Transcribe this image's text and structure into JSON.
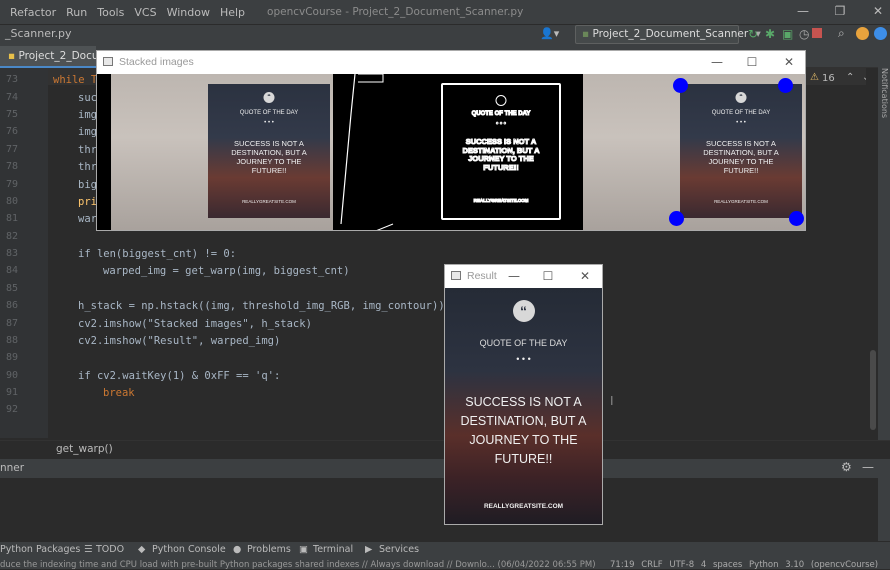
{
  "menu": {
    "items": [
      "Refactor",
      "Run",
      "Tools",
      "VCS",
      "Window",
      "Help"
    ],
    "window_title": "opencvCourse - Project_2_Document_Scanner.py"
  },
  "nav": {
    "crumb": "_Scanner.py",
    "run_config": "Project_2_Document_Scanner",
    "file_tab": "Project_2_Docum"
  },
  "editor": {
    "lines": [
      {
        "num": "73",
        "text": "while True:"
      },
      {
        "num": "74",
        "text": "suc"
      },
      {
        "num": "75",
        "text": "img"
      },
      {
        "num": "76",
        "text": "img"
      },
      {
        "num": "77",
        "text": "thr"
      },
      {
        "num": "78",
        "text": "thr"
      },
      {
        "num": "79",
        "text": "big"
      },
      {
        "num": "80",
        "text": "pri"
      },
      {
        "num": "81",
        "text": "war"
      },
      {
        "num": "82",
        "text": ""
      },
      {
        "num": "83",
        "text": "if len(biggest_cnt) != 0:"
      },
      {
        "num": "84",
        "text": "warped_img = get_warp(img, biggest_cnt)"
      },
      {
        "num": "85",
        "text": ""
      },
      {
        "num": "86",
        "text": "h_stack = np.hstack((img, threshold_img_RGB, img_contour))"
      },
      {
        "num": "87",
        "text": "cv2.imshow(\"Stacked images\", h_stack)"
      },
      {
        "num": "88",
        "text": "cv2.imshow(\"Result\", warped_img)"
      },
      {
        "num": "89",
        "text": ""
      },
      {
        "num": "90",
        "text": "if cv2.waitKey(1) & 0xFF == 'q':"
      },
      {
        "num": "91",
        "text": "break"
      },
      {
        "num": "92",
        "text": ""
      }
    ],
    "warning_count": "16",
    "bottom_crumb": "get_warp()"
  },
  "stacked_window": {
    "title": "Stacked images",
    "card": {
      "quote_of_day": "QUOTE OF THE DAY",
      "dots": "• • •",
      "quote": "SUCCESS IS NOT A\nDESTINATION, BUT A\nJOURNEY TO THE\nFUTURE!!",
      "site": "REALLYGREATSITE.COM"
    }
  },
  "result_window": {
    "title": "Result",
    "quote_of_day": "QUOTE OF THE DAY",
    "dots": "• • •",
    "quote": "SUCCESS IS NOT A\nDESTINATION, BUT A\nJOURNEY TO THE\nFUTURE!!",
    "site": "REALLYGREATSITE.COM"
  },
  "run_panel": {
    "label": "nner"
  },
  "tool_windows": [
    "Python Packages",
    "TODO",
    "Python Console",
    "Problems",
    "Terminal",
    "Services"
  ],
  "status": {
    "message": "duce the indexing time and CPU load with pre-built Python packages shared indexes // Always download // Downlo... (06/04/2022 06:55 PM)",
    "position": "71:19",
    "line_sep": "CRLF",
    "encoding": "UTF-8",
    "indent": "4 spaces",
    "interpreter": "Python 3.10 (opencvCourse)"
  },
  "side": {
    "notifications": "Notifications"
  }
}
